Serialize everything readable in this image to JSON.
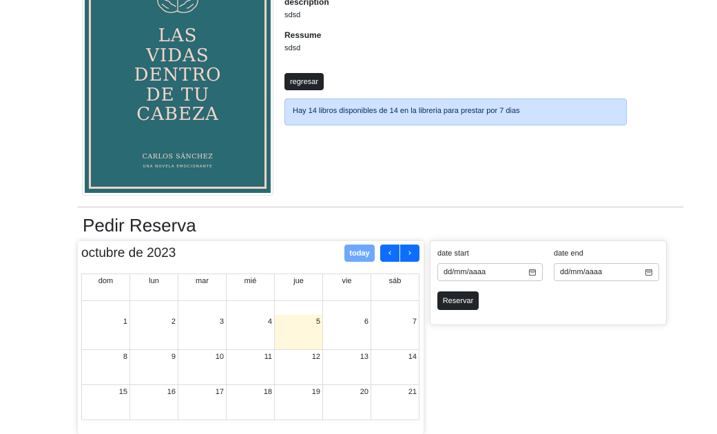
{
  "book": {
    "cover_title_lines": [
      "LAS",
      "VIDAS",
      "DENTRO",
      "DE TU",
      "CABEZA"
    ],
    "cover_author": "CARLOS SÁNCHEZ",
    "cover_tagline": "UNA NOVELA EMOCIONANTE",
    "description_label": "description",
    "description_value": "sdsd",
    "resume_label": "Ressume",
    "resume_value": "sdsd",
    "back_button": "regresar",
    "availability_text": "Hay 14 libros disponibles de 14 en la libreria para prestar por 7 dias"
  },
  "reservation": {
    "section_title": "Pedir Reserva",
    "calendar": {
      "title": "octubre de 2023",
      "today_button": "today",
      "prev_icon": "chevron-left-icon",
      "next_icon": "chevron-right-icon",
      "weekdays": [
        "dom",
        "lun",
        "mar",
        "mié",
        "jue",
        "vie",
        "sáb"
      ],
      "weeks": [
        [
          "1",
          "2",
          "3",
          "4",
          "5",
          "6",
          "7"
        ],
        [
          "8",
          "9",
          "10",
          "11",
          "12",
          "13",
          "14"
        ],
        [
          "15",
          "16",
          "17",
          "18",
          "19",
          "20",
          "21"
        ]
      ],
      "today_date": "5",
      "today_highlight_color": "#fff8dc"
    },
    "form": {
      "start_label": "date start",
      "end_label": "date end",
      "start_placeholder": "dd/mm/aaaa",
      "end_placeholder": "dd/mm/aaaa",
      "submit_button": "Reservar"
    }
  },
  "colors": {
    "cover_bg": "#2a6a72",
    "cover_text": "#f4d6ca",
    "primary": "#0d6efd",
    "dark_button": "#212529",
    "alert_bg": "#cfe2ff"
  }
}
